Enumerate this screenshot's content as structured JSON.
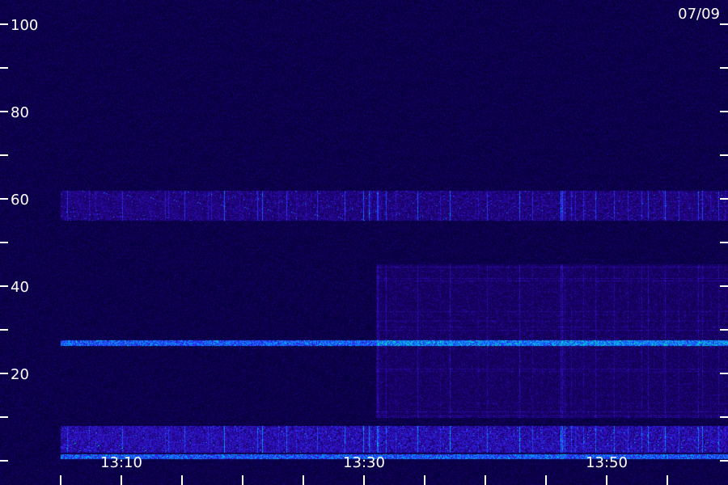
{
  "chart_data": {
    "type": "heatmap",
    "date_label": "07/09",
    "y_axis": {
      "range": [
        0,
        100
      ],
      "tick_labels": [
        "100",
        "80",
        "60",
        "40",
        "20"
      ],
      "tick_values": [
        100,
        80,
        60,
        40,
        20
      ],
      "minor_tick_values": [
        90,
        70,
        50,
        30,
        10,
        0
      ]
    },
    "x_axis": {
      "range": [
        "13:06",
        "13:59"
      ],
      "tick_labels": [
        "13:10",
        "13:30",
        "13:50"
      ],
      "tick_values": [
        "13:10",
        "13:30",
        "13:50"
      ],
      "minor_tick_values": [
        "13:05",
        "13:15",
        "13:20",
        "13:25",
        "13:35",
        "13:40",
        "13:45",
        "13:55"
      ]
    },
    "colormap": [
      "#000033",
      "#1a0066",
      "#3311cc",
      "#2244ff",
      "#00aaff",
      "#00ff88"
    ],
    "features": [
      {
        "kind": "band",
        "y_range": [
          55,
          62
        ],
        "x_range": [
          "13:06",
          "13:59"
        ],
        "intensity": "medium"
      },
      {
        "kind": "diffuse",
        "y_range": [
          10,
          45
        ],
        "x_range": [
          "13:32",
          "13:59"
        ],
        "intensity": "low"
      },
      {
        "kind": "line",
        "y": 27,
        "x_range": [
          "13:06",
          "13:59"
        ],
        "intensity": "high"
      },
      {
        "kind": "band",
        "y_range": [
          2,
          8
        ],
        "x_range": [
          "13:06",
          "13:59"
        ],
        "intensity": "high"
      },
      {
        "kind": "line",
        "y": 1,
        "x_range": [
          "13:06",
          "13:59"
        ],
        "intensity": "high"
      }
    ]
  }
}
